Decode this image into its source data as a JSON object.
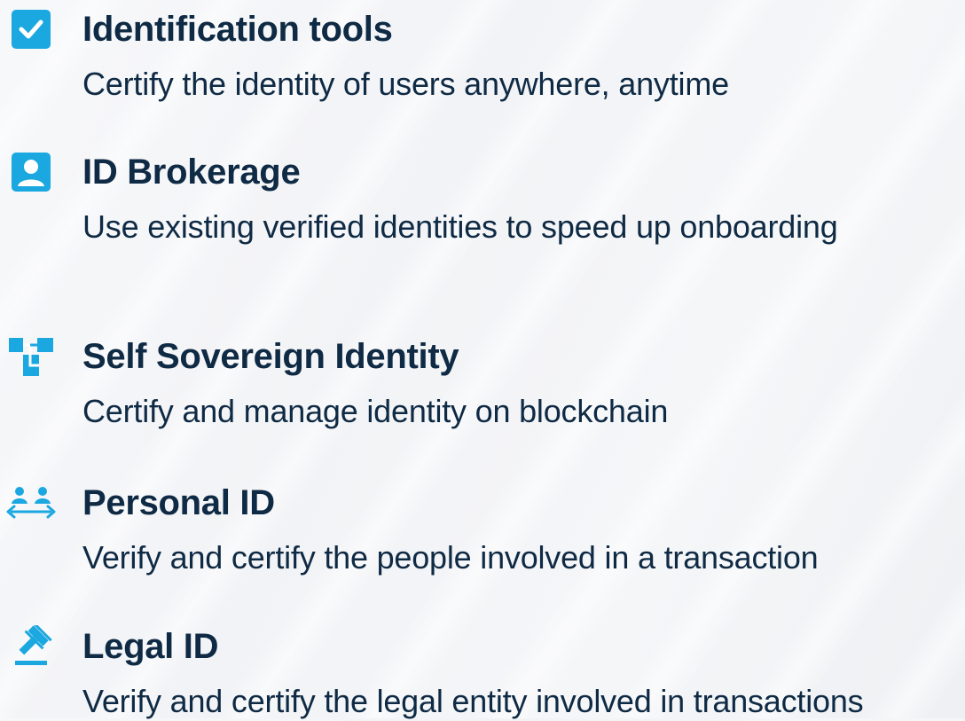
{
  "colors": {
    "accent": "#1ba8e0",
    "text": "#0f2a44"
  },
  "features": [
    {
      "icon": "checkbox-icon",
      "title": "Identification tools",
      "description": "Certify the identity of users anywhere, anytime"
    },
    {
      "icon": "user-id-icon",
      "title": "ID Brokerage",
      "description": "Use existing verified identities to speed up onboarding"
    },
    {
      "icon": "blockchain-icon",
      "title": "Self Sovereign Identity",
      "description": "Certify and manage identity on blockchain"
    },
    {
      "icon": "people-exchange-icon",
      "title": "Personal ID",
      "description": "Verify and certify the people involved in a transaction"
    },
    {
      "icon": "gavel-icon",
      "title": "Legal ID",
      "description": "Verify and certify the legal entity involved in transactions"
    }
  ]
}
